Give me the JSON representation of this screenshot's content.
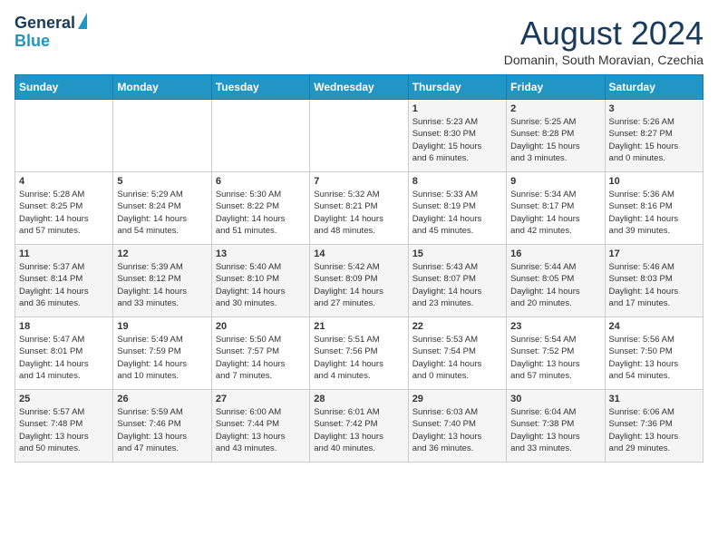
{
  "logo": {
    "line1": "General",
    "line2": "Blue"
  },
  "title": "August 2024",
  "subtitle": "Domanin, South Moravian, Czechia",
  "days_of_week": [
    "Sunday",
    "Monday",
    "Tuesday",
    "Wednesday",
    "Thursday",
    "Friday",
    "Saturday"
  ],
  "weeks": [
    [
      {
        "day": "",
        "info": ""
      },
      {
        "day": "",
        "info": ""
      },
      {
        "day": "",
        "info": ""
      },
      {
        "day": "",
        "info": ""
      },
      {
        "day": "1",
        "info": "Sunrise: 5:23 AM\nSunset: 8:30 PM\nDaylight: 15 hours\nand 6 minutes."
      },
      {
        "day": "2",
        "info": "Sunrise: 5:25 AM\nSunset: 8:28 PM\nDaylight: 15 hours\nand 3 minutes."
      },
      {
        "day": "3",
        "info": "Sunrise: 5:26 AM\nSunset: 8:27 PM\nDaylight: 15 hours\nand 0 minutes."
      }
    ],
    [
      {
        "day": "4",
        "info": "Sunrise: 5:28 AM\nSunset: 8:25 PM\nDaylight: 14 hours\nand 57 minutes."
      },
      {
        "day": "5",
        "info": "Sunrise: 5:29 AM\nSunset: 8:24 PM\nDaylight: 14 hours\nand 54 minutes."
      },
      {
        "day": "6",
        "info": "Sunrise: 5:30 AM\nSunset: 8:22 PM\nDaylight: 14 hours\nand 51 minutes."
      },
      {
        "day": "7",
        "info": "Sunrise: 5:32 AM\nSunset: 8:21 PM\nDaylight: 14 hours\nand 48 minutes."
      },
      {
        "day": "8",
        "info": "Sunrise: 5:33 AM\nSunset: 8:19 PM\nDaylight: 14 hours\nand 45 minutes."
      },
      {
        "day": "9",
        "info": "Sunrise: 5:34 AM\nSunset: 8:17 PM\nDaylight: 14 hours\nand 42 minutes."
      },
      {
        "day": "10",
        "info": "Sunrise: 5:36 AM\nSunset: 8:16 PM\nDaylight: 14 hours\nand 39 minutes."
      }
    ],
    [
      {
        "day": "11",
        "info": "Sunrise: 5:37 AM\nSunset: 8:14 PM\nDaylight: 14 hours\nand 36 minutes."
      },
      {
        "day": "12",
        "info": "Sunrise: 5:39 AM\nSunset: 8:12 PM\nDaylight: 14 hours\nand 33 minutes."
      },
      {
        "day": "13",
        "info": "Sunrise: 5:40 AM\nSunset: 8:10 PM\nDaylight: 14 hours\nand 30 minutes."
      },
      {
        "day": "14",
        "info": "Sunrise: 5:42 AM\nSunset: 8:09 PM\nDaylight: 14 hours\nand 27 minutes."
      },
      {
        "day": "15",
        "info": "Sunrise: 5:43 AM\nSunset: 8:07 PM\nDaylight: 14 hours\nand 23 minutes."
      },
      {
        "day": "16",
        "info": "Sunrise: 5:44 AM\nSunset: 8:05 PM\nDaylight: 14 hours\nand 20 minutes."
      },
      {
        "day": "17",
        "info": "Sunrise: 5:46 AM\nSunset: 8:03 PM\nDaylight: 14 hours\nand 17 minutes."
      }
    ],
    [
      {
        "day": "18",
        "info": "Sunrise: 5:47 AM\nSunset: 8:01 PM\nDaylight: 14 hours\nand 14 minutes."
      },
      {
        "day": "19",
        "info": "Sunrise: 5:49 AM\nSunset: 7:59 PM\nDaylight: 14 hours\nand 10 minutes."
      },
      {
        "day": "20",
        "info": "Sunrise: 5:50 AM\nSunset: 7:57 PM\nDaylight: 14 hours\nand 7 minutes."
      },
      {
        "day": "21",
        "info": "Sunrise: 5:51 AM\nSunset: 7:56 PM\nDaylight: 14 hours\nand 4 minutes."
      },
      {
        "day": "22",
        "info": "Sunrise: 5:53 AM\nSunset: 7:54 PM\nDaylight: 14 hours\nand 0 minutes."
      },
      {
        "day": "23",
        "info": "Sunrise: 5:54 AM\nSunset: 7:52 PM\nDaylight: 13 hours\nand 57 minutes."
      },
      {
        "day": "24",
        "info": "Sunrise: 5:56 AM\nSunset: 7:50 PM\nDaylight: 13 hours\nand 54 minutes."
      }
    ],
    [
      {
        "day": "25",
        "info": "Sunrise: 5:57 AM\nSunset: 7:48 PM\nDaylight: 13 hours\nand 50 minutes."
      },
      {
        "day": "26",
        "info": "Sunrise: 5:59 AM\nSunset: 7:46 PM\nDaylight: 13 hours\nand 47 minutes."
      },
      {
        "day": "27",
        "info": "Sunrise: 6:00 AM\nSunset: 7:44 PM\nDaylight: 13 hours\nand 43 minutes."
      },
      {
        "day": "28",
        "info": "Sunrise: 6:01 AM\nSunset: 7:42 PM\nDaylight: 13 hours\nand 40 minutes."
      },
      {
        "day": "29",
        "info": "Sunrise: 6:03 AM\nSunset: 7:40 PM\nDaylight: 13 hours\nand 36 minutes."
      },
      {
        "day": "30",
        "info": "Sunrise: 6:04 AM\nSunset: 7:38 PM\nDaylight: 13 hours\nand 33 minutes."
      },
      {
        "day": "31",
        "info": "Sunrise: 6:06 AM\nSunset: 7:36 PM\nDaylight: 13 hours\nand 29 minutes."
      }
    ]
  ]
}
